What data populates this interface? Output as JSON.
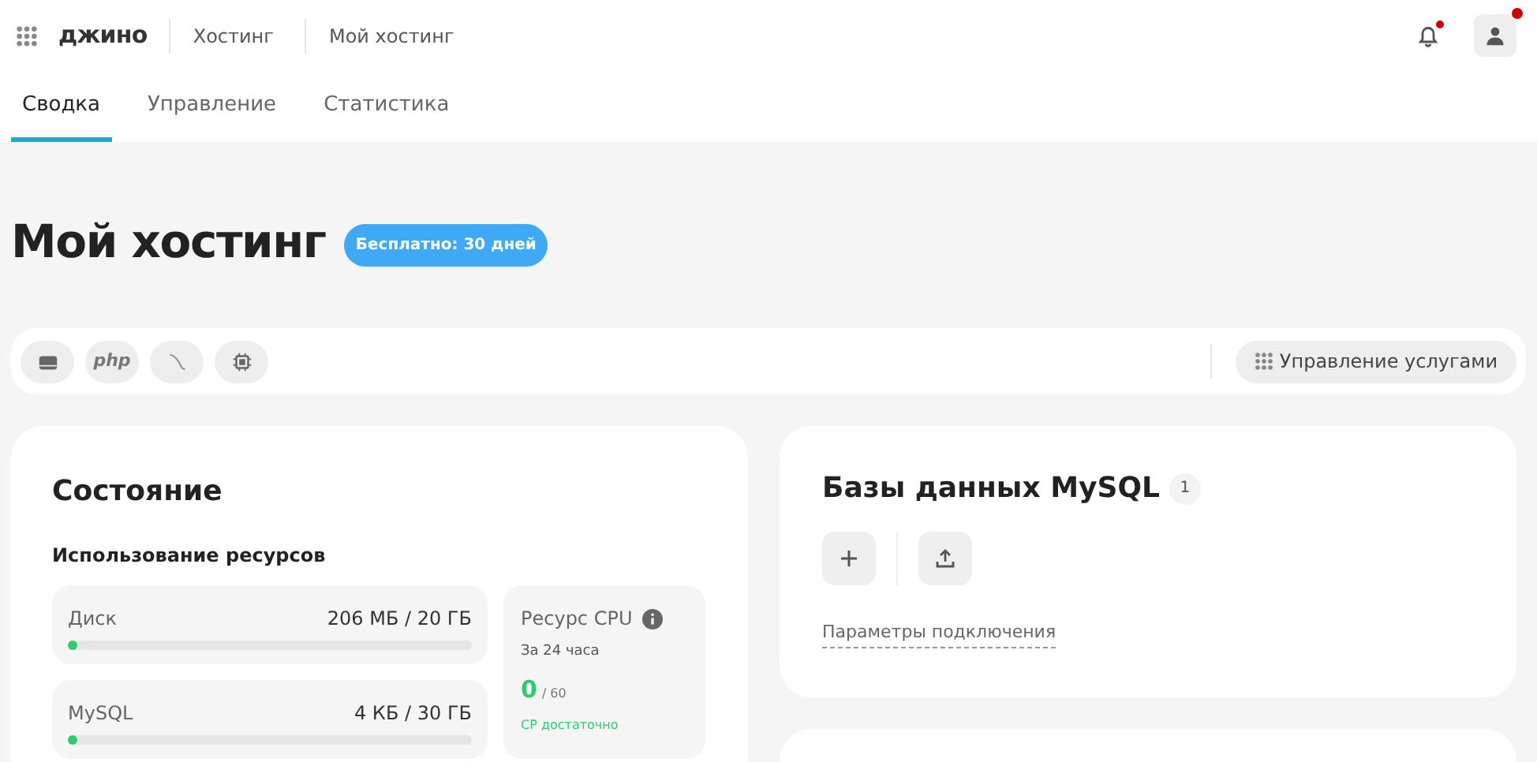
{
  "header": {
    "logo": "джино",
    "breadcrumbs": [
      "Хостинг",
      "Мой хостинг"
    ],
    "notifications": {
      "has_alert": true
    },
    "account": {
      "has_alert": true
    }
  },
  "tabs": [
    {
      "label": "Сводка",
      "selected": true
    },
    {
      "label": "Управление",
      "selected": false
    },
    {
      "label": "Статистика",
      "selected": false
    }
  ],
  "page": {
    "title": "Мой хостинг",
    "badge": "Бесплатно: 30 дней"
  },
  "toolbar": {
    "services": [
      {
        "kind": "disk"
      },
      {
        "kind": "php",
        "label": "php"
      },
      {
        "kind": "mysql"
      },
      {
        "kind": "cpu"
      }
    ],
    "manage_button": "Управление услугами"
  },
  "status_card": {
    "title": "Состояние",
    "subtitle": "Использование ресурсов",
    "meters": [
      {
        "name": "Диск",
        "reading": "206 МБ / 20 ГБ",
        "level": 0.01
      },
      {
        "name": "MySQL",
        "reading": "4 КБ / 30 ГБ",
        "level": 0.0
      }
    ],
    "cpu": {
      "title": "Ресурс CPU",
      "period": "За 24 часа",
      "value": "0",
      "limit": "/ 60",
      "note": "CP достаточно"
    }
  },
  "mysql_card": {
    "title": "Базы данных MySQL",
    "count": "1",
    "actions": [
      {
        "kind": "add"
      },
      {
        "kind": "upload"
      }
    ],
    "link": "Параметры подключения"
  }
}
